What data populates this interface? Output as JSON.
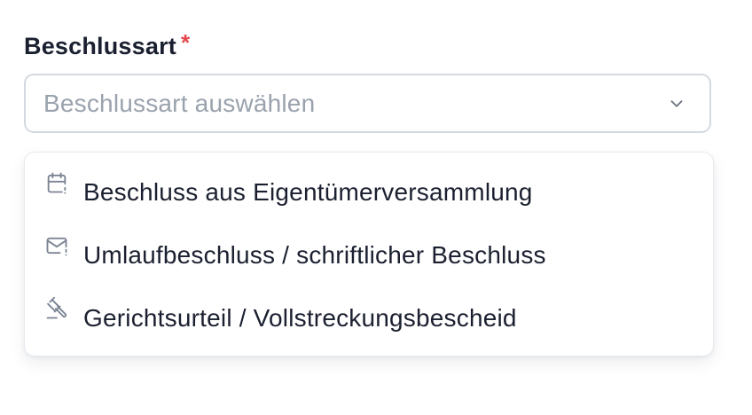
{
  "field": {
    "label": "Beschlussart",
    "required_marker": "*",
    "placeholder": "Beschlussart auswählen"
  },
  "dropdown": {
    "items": [
      {
        "label": "Beschluss aus Eigentümerversammlung",
        "icon": "calendar-alert-icon"
      },
      {
        "label": "Umlaufbeschluss / schriftlicher Beschluss",
        "icon": "mail-alert-icon"
      },
      {
        "label": "Gerichtsurteil / Vollstreckungsbescheid",
        "icon": "gavel-icon"
      }
    ]
  },
  "colors": {
    "required": "#e5484d",
    "placeholder": "#9aa2ad",
    "icon": "#7b8493",
    "border": "#d4d9e0",
    "text": "#1b2030"
  }
}
